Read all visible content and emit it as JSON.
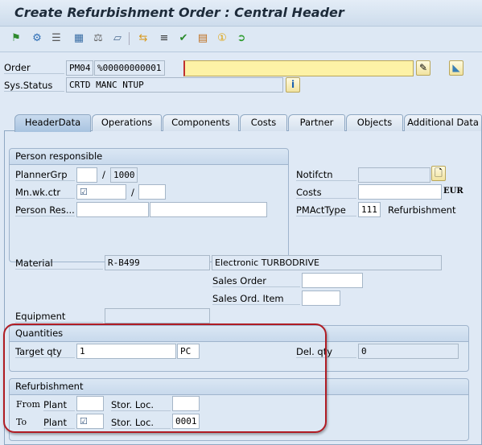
{
  "title": "Create Refurbishment Order : Central Header",
  "toolbar": {
    "icons": [
      "flag-icon",
      "settings-icon",
      "list-icon",
      "calculator-icon",
      "hierarchy-icon",
      "document-icon",
      "transfer-icon",
      "text-icon",
      "check-icon",
      "clipboard-icon",
      "info-number-icon",
      "forward-icon"
    ]
  },
  "header": {
    "order_label": "Order",
    "order_type": "PM04",
    "order_number": "%00000000001",
    "order_text": "",
    "status_label": "Sys.Status",
    "status_value": "CRTD MANC NTUP"
  },
  "tabs": [
    {
      "label": "HeaderData"
    },
    {
      "label": "Operations"
    },
    {
      "label": "Components"
    },
    {
      "label": "Costs"
    },
    {
      "label": "Partner"
    },
    {
      "label": "Objects"
    },
    {
      "label": "Additional Data"
    }
  ],
  "person": {
    "title": "Person responsible",
    "planner_label": "PlannerGrp",
    "planner_value": "",
    "planner_plant": "1000",
    "slash": "/",
    "wkctr_label": "Mn.wk.ctr",
    "wkctr_value": "☑",
    "wkctr_plant": "",
    "person_label": "Person Res...",
    "person_value": "",
    "person_name": ""
  },
  "right": {
    "notif_label": "Notifctn",
    "notif_value": "",
    "costs_label": "Costs",
    "costs_value": "",
    "currency": "EUR",
    "acttype_label": "PMActType",
    "acttype_value": "111",
    "acttype_text": "Refurbishment"
  },
  "material": {
    "label": "Material",
    "value": "R-B499",
    "desc": "Electronic TURBODRIVE",
    "sales_order_label": "Sales Order",
    "sales_order_value": "",
    "sales_item_label": "Sales Ord. Item",
    "sales_item_value": "",
    "equipment_label": "Equipment",
    "equipment_value": ""
  },
  "quantities": {
    "title": "Quantities",
    "target_label": "Target qty",
    "target_value": "1",
    "unit": "PC",
    "del_label": "Del. qty",
    "del_value": "0"
  },
  "refurb": {
    "title": "Refurbishment",
    "from_label": "From",
    "to_label": "To",
    "plant_label": "Plant",
    "sloc_label": "Stor. Loc.",
    "from_plant": "",
    "from_sloc": "",
    "to_plant": "☑",
    "to_sloc": "0001"
  },
  "colors": {
    "highlight": "#b01c24",
    "required_field": "#fdf2a6"
  }
}
